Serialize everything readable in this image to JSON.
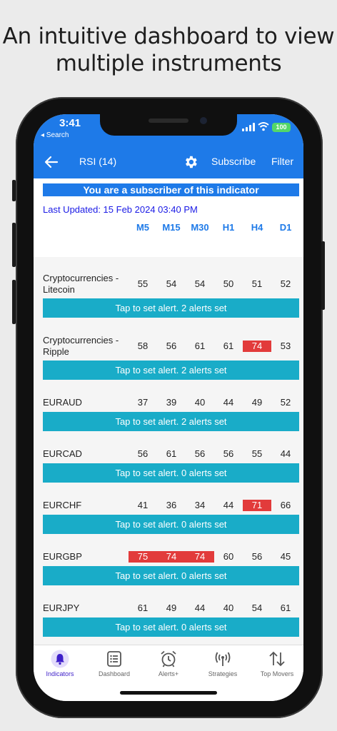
{
  "headline": {
    "line1": "An intuitive dashboard to view",
    "line2": "multiple instruments"
  },
  "status": {
    "time": "3:41",
    "back_label": "◂ Search",
    "battery": "100"
  },
  "appbar": {
    "title": "RSI (14)",
    "subscribe": "Subscribe",
    "filter": "Filter"
  },
  "banner": "You are a subscriber of this indicator",
  "last_updated": "Last Updated: 15 Feb 2024 03:40 PM",
  "timeframes": [
    "M5",
    "M15",
    "M30",
    "H1",
    "H4",
    "D1"
  ],
  "rows": [
    {
      "name": "Cryptocurrencies - Litecoin",
      "values": [
        "55",
        "54",
        "54",
        "50",
        "51",
        "52"
      ],
      "alert": "Tap to set alert. 2 alerts set"
    },
    {
      "name": "Cryptocurrencies - Ripple",
      "values": [
        "58",
        "56",
        "61",
        "61",
        "74",
        "53"
      ],
      "alert": "Tap to set alert. 2 alerts set"
    },
    {
      "name": "EURAUD",
      "values": [
        "37",
        "39",
        "40",
        "44",
        "49",
        "52"
      ],
      "alert": "Tap to set alert. 2 alerts set"
    },
    {
      "name": "EURCAD",
      "values": [
        "56",
        "61",
        "56",
        "56",
        "55",
        "44"
      ],
      "alert": "Tap to set alert. 0 alerts set"
    },
    {
      "name": "EURCHF",
      "values": [
        "41",
        "36",
        "34",
        "44",
        "71",
        "66"
      ],
      "alert": "Tap to set alert. 0 alerts set"
    },
    {
      "name": "EURGBP",
      "values": [
        "75",
        "74",
        "74",
        "60",
        "56",
        "45"
      ],
      "alert": "Tap to set alert. 0 alerts set"
    },
    {
      "name": "EURJPY",
      "values": [
        "61",
        "49",
        "44",
        "40",
        "54",
        "61"
      ],
      "alert": "Tap to set alert. 0 alerts set"
    }
  ],
  "colors": {
    "primary": "#1e7ae8",
    "alert_button": "#19acc8",
    "overbought": "#e23b3b",
    "active_tab": "#3d1ec9"
  },
  "tabs": [
    {
      "label": "Indicators",
      "icon": "bell-icon",
      "active": true
    },
    {
      "label": "Dashboard",
      "icon": "list-icon",
      "active": false
    },
    {
      "label": "Alerts+",
      "icon": "alarm-clock-icon",
      "active": false
    },
    {
      "label": "Strategies",
      "icon": "broadcast-icon",
      "active": false
    },
    {
      "label": "Top Movers",
      "icon": "up-down-arrows-icon",
      "active": false
    }
  ]
}
